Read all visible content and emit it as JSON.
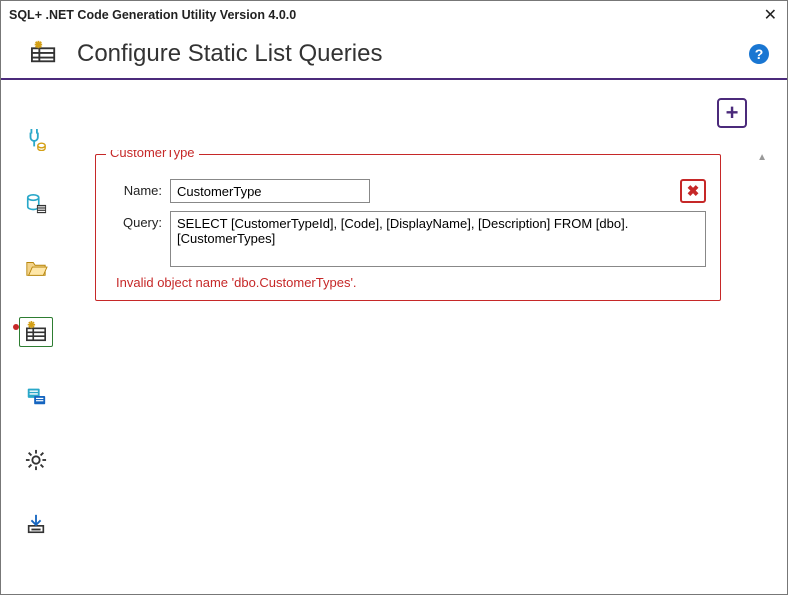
{
  "window": {
    "title": "SQL+ .NET Code Generation Utility Version 4.0.0",
    "close_glyph": "✕"
  },
  "header": {
    "page_title": "Configure Static List Queries",
    "help_glyph": "?"
  },
  "sidebar": {
    "items": [
      {
        "name": "nav-connect",
        "active": false
      },
      {
        "name": "nav-database",
        "active": false
      },
      {
        "name": "nav-folder",
        "active": false
      },
      {
        "name": "nav-static-list",
        "active": true
      },
      {
        "name": "nav-enums",
        "active": false
      },
      {
        "name": "nav-settings",
        "active": false
      },
      {
        "name": "nav-build",
        "active": false
      }
    ]
  },
  "toolbar": {
    "add_glyph": "+"
  },
  "queries": [
    {
      "legend": "CustomerType",
      "name_label": "Name:",
      "name_value": "CustomerType",
      "query_label": "Query:",
      "query_value": "SELECT [CustomerTypeId], [Code], [DisplayName], [Description] FROM [dbo].[CustomerTypes]",
      "delete_glyph": "✖",
      "error": "Invalid object name 'dbo.CustomerTypes'."
    }
  ]
}
